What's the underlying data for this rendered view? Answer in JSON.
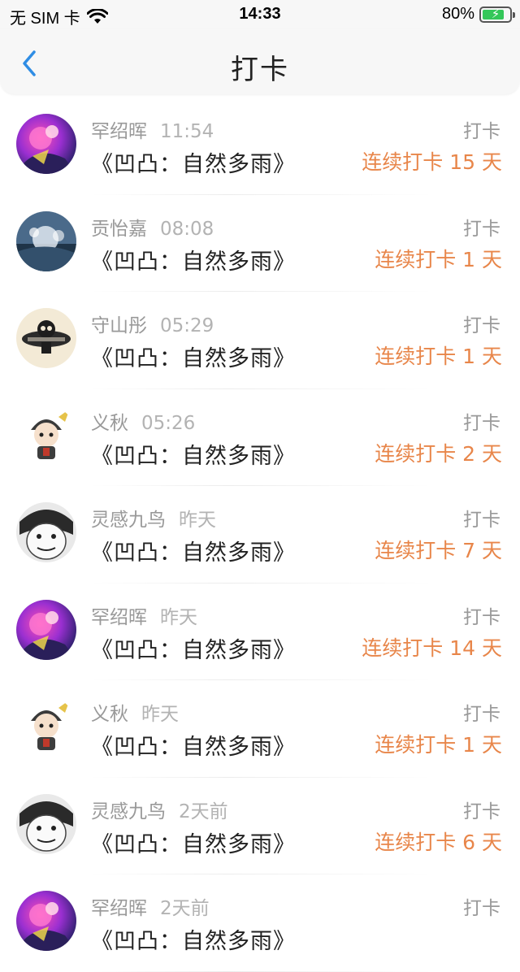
{
  "status": {
    "carrier": "无 SIM 卡",
    "time": "14:33",
    "battery_percent": "80%",
    "battery_level": 0.8,
    "icons": [
      "wifi-icon",
      "battery-charging-icon"
    ]
  },
  "nav": {
    "title": "打卡",
    "back_icon": "chevron-left-icon",
    "accent_color": "#2f8de4"
  },
  "colors": {
    "streak": "#e8864a",
    "meta": "#999999"
  },
  "items": [
    {
      "user": "罕绍晖",
      "when": "11:54",
      "book": "《凹凸：自然多雨》",
      "type": "打卡",
      "streak": "连续打卡 15 天",
      "avatar": "avatar-pink-anime"
    },
    {
      "user": "贡怡嘉",
      "when": "08:08",
      "book": "《凹凸：自然多雨》",
      "type": "打卡",
      "streak": "连续打卡 1 天",
      "avatar": "avatar-splash"
    },
    {
      "user": "守山彤",
      "when": "05:29",
      "book": "《凹凸：自然多雨》",
      "type": "打卡",
      "streak": "连续打卡 1 天",
      "avatar": "avatar-skull-logo"
    },
    {
      "user": "义秋",
      "when": "05:26",
      "book": "《凹凸：自然多雨》",
      "type": "打卡",
      "streak": "连续打卡 2 天",
      "avatar": "avatar-chibi"
    },
    {
      "user": "灵感九鸟",
      "when": "昨天",
      "book": "《凹凸：自然多雨》",
      "type": "打卡",
      "streak": "连续打卡 7 天",
      "avatar": "avatar-meme-face"
    },
    {
      "user": "罕绍晖",
      "when": "昨天",
      "book": "《凹凸：自然多雨》",
      "type": "打卡",
      "streak": "连续打卡 14 天",
      "avatar": "avatar-pink-anime"
    },
    {
      "user": "义秋",
      "when": "昨天",
      "book": "《凹凸：自然多雨》",
      "type": "打卡",
      "streak": "连续打卡 1 天",
      "avatar": "avatar-chibi"
    },
    {
      "user": "灵感九鸟",
      "when": "2天前",
      "book": "《凹凸：自然多雨》",
      "type": "打卡",
      "streak": "连续打卡 6 天",
      "avatar": "avatar-meme-face"
    },
    {
      "user": "罕绍晖",
      "when": "2天前",
      "book": "《凹凸：自然多雨》",
      "type": "打卡",
      "streak": "",
      "avatar": "avatar-pink-anime"
    }
  ]
}
